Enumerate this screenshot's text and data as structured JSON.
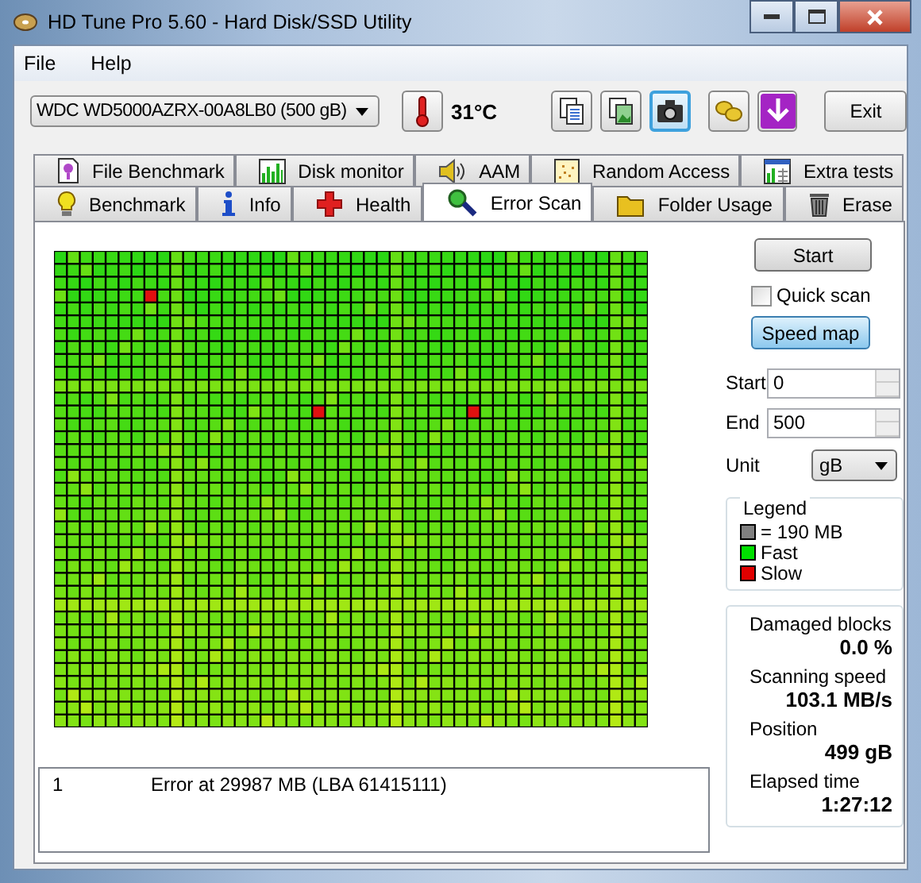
{
  "window": {
    "title": "HD Tune Pro 5.60 - Hard Disk/SSD Utility"
  },
  "menu": [
    {
      "label": "File"
    },
    {
      "label": "Help"
    }
  ],
  "toolbar": {
    "drive": "WDC WD5000AZRX-00A8LB0 (500 gB)",
    "temperature": "31°C",
    "buttons": [
      {
        "kind": "copy-text",
        "focused": false
      },
      {
        "kind": "copy-screen",
        "focused": false
      },
      {
        "kind": "camera",
        "focused": true
      },
      {
        "kind": "coins",
        "focused": false
      },
      {
        "kind": "download",
        "focused": false
      }
    ],
    "exit": "Exit"
  },
  "tabs_top": [
    {
      "label": "File Benchmark",
      "kind": "file"
    },
    {
      "label": "Disk monitor",
      "kind": "monitor"
    },
    {
      "label": "AAM",
      "kind": "speaker"
    },
    {
      "label": "Random Access",
      "kind": "random"
    },
    {
      "label": "Extra tests",
      "kind": "extra"
    }
  ],
  "tabs_bottom": [
    {
      "label": "Benchmark",
      "kind": "bulb",
      "selected": false
    },
    {
      "label": "Info",
      "kind": "info",
      "selected": false
    },
    {
      "label": "Health",
      "kind": "cross",
      "selected": false
    },
    {
      "label": "Error Scan",
      "kind": "magnifier",
      "selected": true
    },
    {
      "label": "Folder Usage",
      "kind": "folder",
      "selected": false
    },
    {
      "label": "Erase",
      "kind": "trash",
      "selected": false
    }
  ],
  "log": [
    {
      "number": "1",
      "message": "Error at 29987 MB (LBA 61415111)"
    }
  ],
  "side": {
    "start_button": "Start",
    "quick_scan": {
      "label": "Quick scan",
      "checked": false
    },
    "speed_map": {
      "label": "Speed map",
      "pressed": true
    },
    "start": {
      "label": "Start",
      "value": "0"
    },
    "end": {
      "label": "End",
      "value": "500"
    },
    "unit": {
      "label": "Unit",
      "value": "gB"
    },
    "legend": {
      "title": "Legend",
      "items": [
        {
          "label": "= 190 MB",
          "color": "#808080"
        },
        {
          "label": "Fast",
          "color": "#00e000"
        },
        {
          "label": "Slow",
          "color": "#e00000"
        }
      ]
    },
    "stats": [
      {
        "label": "Damaged blocks",
        "value": "0.0 %"
      },
      {
        "label": "Scanning speed",
        "value": "103.1 MB/s"
      },
      {
        "label": "Position",
        "value": "499 gB"
      },
      {
        "label": "Elapsed time",
        "value": "1:27:12"
      }
    ]
  }
}
